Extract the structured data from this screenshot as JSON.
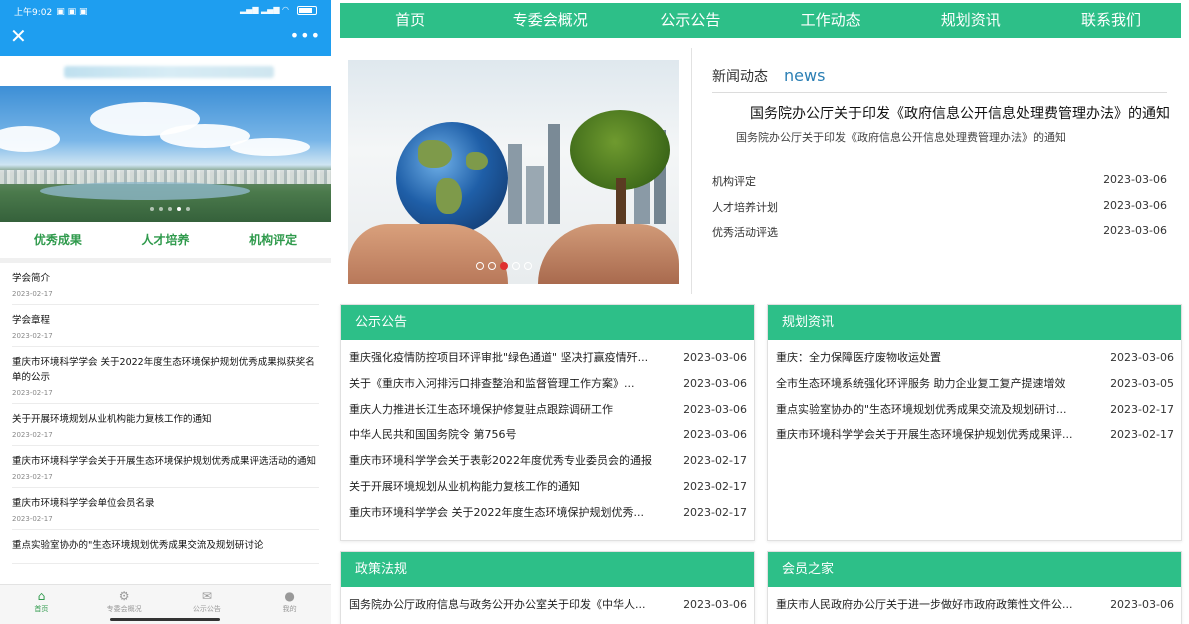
{
  "mobile": {
    "status_time": "上午9:02",
    "close_icon": "close-icon",
    "more_icon": "more-icon",
    "quick_links": [
      "优秀成果",
      "人才培养",
      "机构评定"
    ],
    "list": [
      {
        "title": "学会简介",
        "date": "2023-02-17"
      },
      {
        "title": "学会章程",
        "date": "2023-02-17"
      },
      {
        "title": "重庆市环境科学学会 关于2022年度生态环境保护规划优秀成果拟获奖名单的公示",
        "date": "2023-02-17"
      },
      {
        "title": "关于开展环境规划从业机构能力复核工作的通知",
        "date": "2023-02-17"
      },
      {
        "title": "重庆市环境科学学会关于开展生态环境保护规划优秀成果评选活动的通知",
        "date": "2023-02-17"
      },
      {
        "title": "重庆市环境科学学会单位会员名录",
        "date": "2023-02-17"
      },
      {
        "title": "重点实验室协办的\"生态环境规划优秀成果交流及规划研讨论",
        "date": ""
      }
    ],
    "tabs": [
      {
        "label": "首页",
        "icon": "home-icon"
      },
      {
        "label": "专委会概况",
        "icon": "gear-icon"
      },
      {
        "label": "公示公告",
        "icon": "mail-icon"
      },
      {
        "label": "我的",
        "icon": "user-icon"
      }
    ]
  },
  "desktop": {
    "nav": [
      "首页",
      "专委会概况",
      "公示公告",
      "工作动态",
      "规划资讯",
      "联系我们"
    ],
    "news": {
      "heading": "新闻动态",
      "heading_en": "news",
      "feature_title": "国务院办公厅关于印发《政府信息公开信息处理费管理办法》的通知",
      "feature_sub": "国务院办公厅关于印发《政府信息公开信息处理费管理办法》的通知",
      "items": [
        {
          "title": "机构评定",
          "date": "2023-03-06"
        },
        {
          "title": "人才培养计划",
          "date": "2023-03-06"
        },
        {
          "title": "优秀活动评选",
          "date": "2023-03-06"
        }
      ]
    },
    "panels": {
      "notice": {
        "title": "公示公告",
        "items": [
          {
            "title": "重庆强化疫情防控项目环评审批\"绿色通道\" 坚决打赢疫情歼...",
            "date": "2023-03-06"
          },
          {
            "title": "关于《重庆市入河排污口排查整治和监督管理工作方案》...",
            "date": "2023-03-06"
          },
          {
            "title": "重庆人力推进长江生态环境保护修复驻点跟踪调研工作",
            "date": "2023-03-06"
          },
          {
            "title": "中华人民共和国国务院令 第756号",
            "date": "2023-03-06"
          },
          {
            "title": "重庆市环境科学学会关于表彰2022年度优秀专业委员会的通报",
            "date": "2023-02-17"
          },
          {
            "title": "关于开展环境规划从业机构能力复核工作的通知",
            "date": "2023-02-17"
          },
          {
            "title": "重庆市环境科学学会 关于2022年度生态环境保护规划优秀...",
            "date": "2023-02-17"
          }
        ]
      },
      "planning": {
        "title": "规划资讯",
        "items": [
          {
            "title": "重庆：全力保障医疗废物收运处置",
            "date": "2023-03-06"
          },
          {
            "title": "全市生态环境系统强化环评服务 助力企业复工复产提速增效",
            "date": "2023-03-05"
          },
          {
            "title": "重点实验室协办的\"生态环境规划优秀成果交流及规划研讨...",
            "date": "2023-02-17"
          },
          {
            "title": "重庆市环境科学学会关于开展生态环境保护规划优秀成果评...",
            "date": "2023-02-17"
          }
        ]
      },
      "policy": {
        "title": "政策法规",
        "items": [
          {
            "title": "国务院办公厅政府信息与政务公开办公室关于印发《中华人...",
            "date": "2023-03-06"
          }
        ]
      },
      "members": {
        "title": "会员之家",
        "items": [
          {
            "title": "重庆市人民政府办公厅关于进一步做好市政府政策性文件公...",
            "date": "2023-03-06"
          }
        ]
      }
    }
  }
}
